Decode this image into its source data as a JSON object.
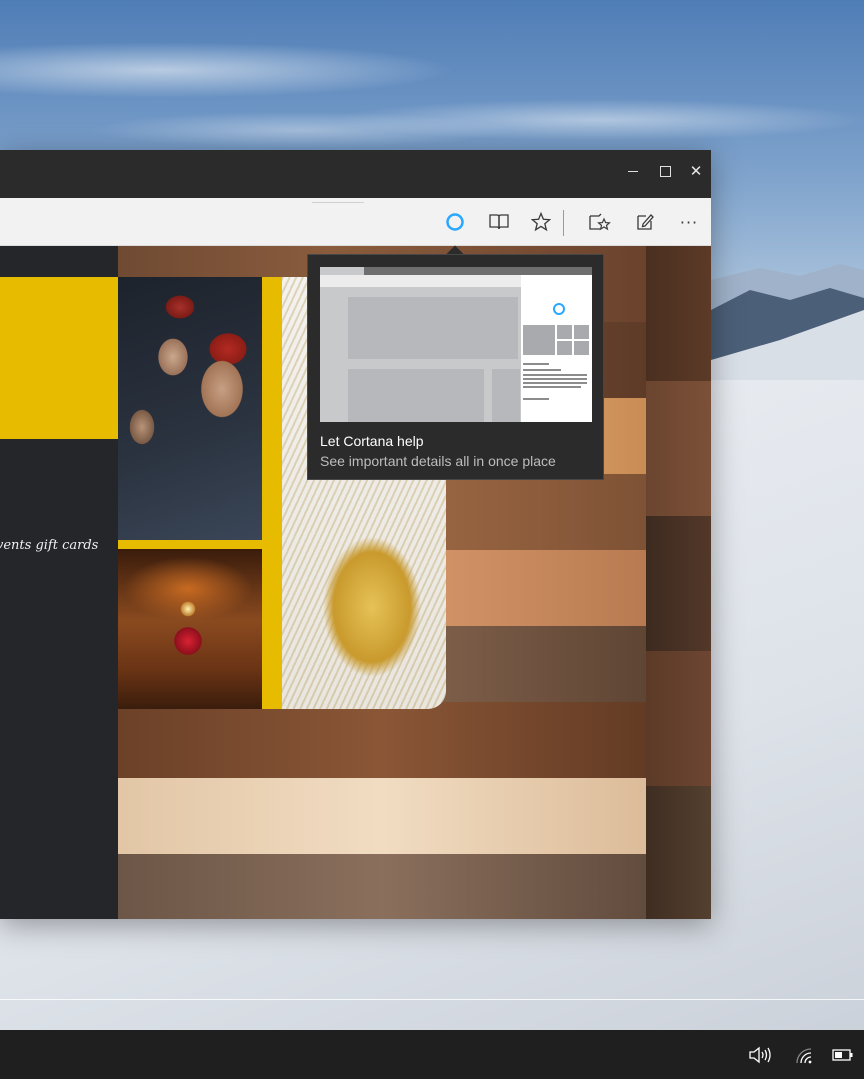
{
  "browser": {
    "title_controls": {
      "minimize": "minimize-icon",
      "maximize": "maximize-icon",
      "close": "close-icon"
    },
    "toolbar_icons": [
      "cortana-icon",
      "reading-view-icon",
      "favorites-star-icon",
      "hub-icon",
      "web-note-icon",
      "more-icon"
    ],
    "more_label": "···",
    "close_glyph": "✕"
  },
  "website": {
    "nav_links": "vents  gift cards"
  },
  "tooltip": {
    "title": "Let Cortana help",
    "description": "See important details all in once place"
  },
  "taskbar": {
    "tray_icons": [
      "volume-icon",
      "wifi-icon",
      "battery-icon"
    ]
  },
  "colors": {
    "accent_blue": "#2aa7ff",
    "site_yellow": "#e7bc00",
    "title_bar": "#2b2b2b",
    "taskbar": "#1f1f1f"
  }
}
